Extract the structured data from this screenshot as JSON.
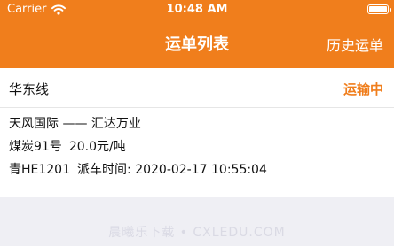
{
  "status_bar": {
    "carrier": "Carrier",
    "time": "10:48 AM",
    "icons": [
      "wifi-icon",
      "battery-icon"
    ]
  },
  "nav": {
    "title": "运单列表",
    "right_button": "历史运单"
  },
  "waybill": {
    "route_name": "华东线",
    "status": "运输中",
    "from": "天风国际",
    "separator": "——",
    "to": "汇达万业",
    "cargo": "煤炭91号",
    "price": "20.0元/吨",
    "plate": "青HE1201",
    "dispatch_label": "派车时间:",
    "dispatch_time": "2020-02-17 10:55:04"
  },
  "watermark": "晨曦乐下载 • CXLEDU.COM",
  "colors": {
    "accent": "#f07e1c",
    "background": "#efeff4",
    "card": "#ffffff",
    "text": "#111111"
  }
}
